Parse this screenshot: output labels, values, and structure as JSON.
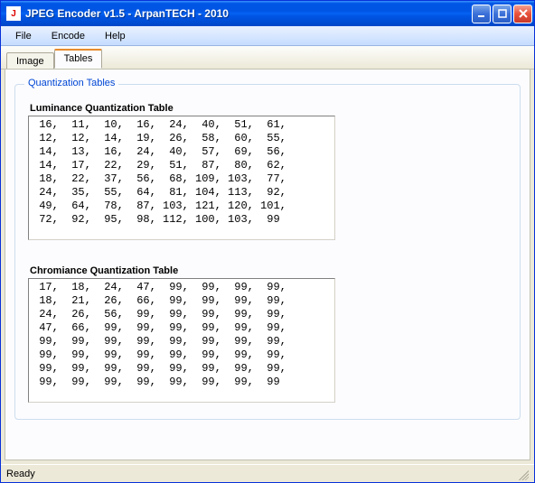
{
  "window": {
    "title": "JPEG Encoder v1.5 - ArpanTECH - 2010"
  },
  "menu": {
    "file": "File",
    "encode": "Encode",
    "help": "Help"
  },
  "tabs": {
    "image": "Image",
    "tables": "Tables"
  },
  "group": {
    "title": "Quantization Tables"
  },
  "lum": {
    "title": "Luminance Quantization Table",
    "rows": [
      [
        16,
        11,
        10,
        16,
        24,
        40,
        51,
        61
      ],
      [
        12,
        12,
        14,
        19,
        26,
        58,
        60,
        55
      ],
      [
        14,
        13,
        16,
        24,
        40,
        57,
        69,
        56
      ],
      [
        14,
        17,
        22,
        29,
        51,
        87,
        80,
        62
      ],
      [
        18,
        22,
        37,
        56,
        68,
        109,
        103,
        77
      ],
      [
        24,
        35,
        55,
        64,
        81,
        104,
        113,
        92
      ],
      [
        49,
        64,
        78,
        87,
        103,
        121,
        120,
        101
      ],
      [
        72,
        92,
        95,
        98,
        112,
        100,
        103,
        99
      ]
    ]
  },
  "chrom": {
    "title": "Chromiance Quantization Table",
    "rows": [
      [
        17,
        18,
        24,
        47,
        99,
        99,
        99,
        99
      ],
      [
        18,
        21,
        26,
        66,
        99,
        99,
        99,
        99
      ],
      [
        24,
        26,
        56,
        99,
        99,
        99,
        99,
        99
      ],
      [
        47,
        66,
        99,
        99,
        99,
        99,
        99,
        99
      ],
      [
        99,
        99,
        99,
        99,
        99,
        99,
        99,
        99
      ],
      [
        99,
        99,
        99,
        99,
        99,
        99,
        99,
        99
      ],
      [
        99,
        99,
        99,
        99,
        99,
        99,
        99,
        99
      ],
      [
        99,
        99,
        99,
        99,
        99,
        99,
        99,
        99
      ]
    ]
  },
  "status": {
    "text": "Ready"
  }
}
